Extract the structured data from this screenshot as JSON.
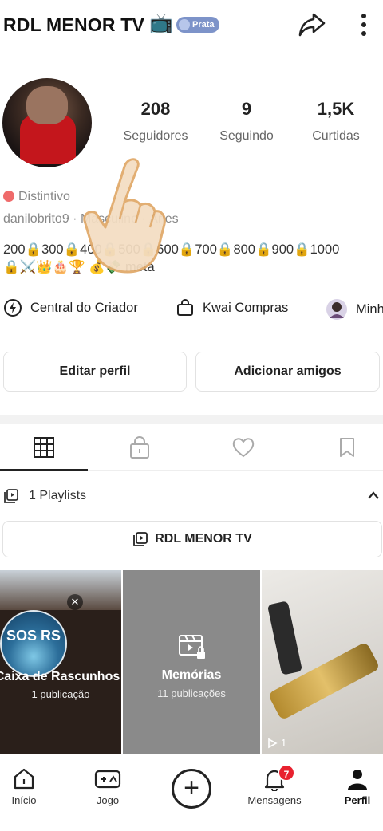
{
  "header": {
    "title": "RDL MENOR TV",
    "tv_emoji": "📺",
    "badge": "Prata",
    "icons": [
      "share-icon",
      "more-icon"
    ]
  },
  "profile": {
    "stats": [
      {
        "value": "208",
        "label": "Seguidores"
      },
      {
        "value": "9",
        "label": "Seguindo"
      },
      {
        "value": "1,5K",
        "label": "Curtidas"
      }
    ],
    "distintivo": "Distintivo",
    "meta_line": "danilobrito9  ·  Masculino  ·  Áries",
    "bio_line1": "200🔒300🔒400🔒500🔒600🔒700🔒800🔒900🔒1000",
    "bio_line2": "🔒⚔️👑🎂🏆  💰💸 meta"
  },
  "tools": [
    {
      "label": "Central do Criador",
      "icon": "creator-center-icon"
    },
    {
      "label": "Kwai Compras",
      "icon": "shopping-bag-icon"
    },
    {
      "label": "Minh",
      "icon": "avatar-mini-icon"
    }
  ],
  "buttons": {
    "edit": "Editar perfil",
    "add_friends": "Adicionar amigos"
  },
  "tabs": [
    "grid-icon",
    "lock-icon",
    "heart-icon",
    "bookmark-icon"
  ],
  "playlists": {
    "label": "1 Playlists",
    "item": "RDL MENOR TV"
  },
  "grid": {
    "drafts": {
      "badge_text": "SOS RS",
      "title": "Caixa de Rascunhos",
      "sub": "1 publicação"
    },
    "memories": {
      "title": "Memórias",
      "sub": "11 publicações"
    },
    "video": {
      "plays": "1"
    }
  },
  "nav": {
    "home": "Início",
    "game": "Jogo",
    "messages": "Mensagens",
    "messages_badge": "7",
    "profile": "Perfil"
  }
}
